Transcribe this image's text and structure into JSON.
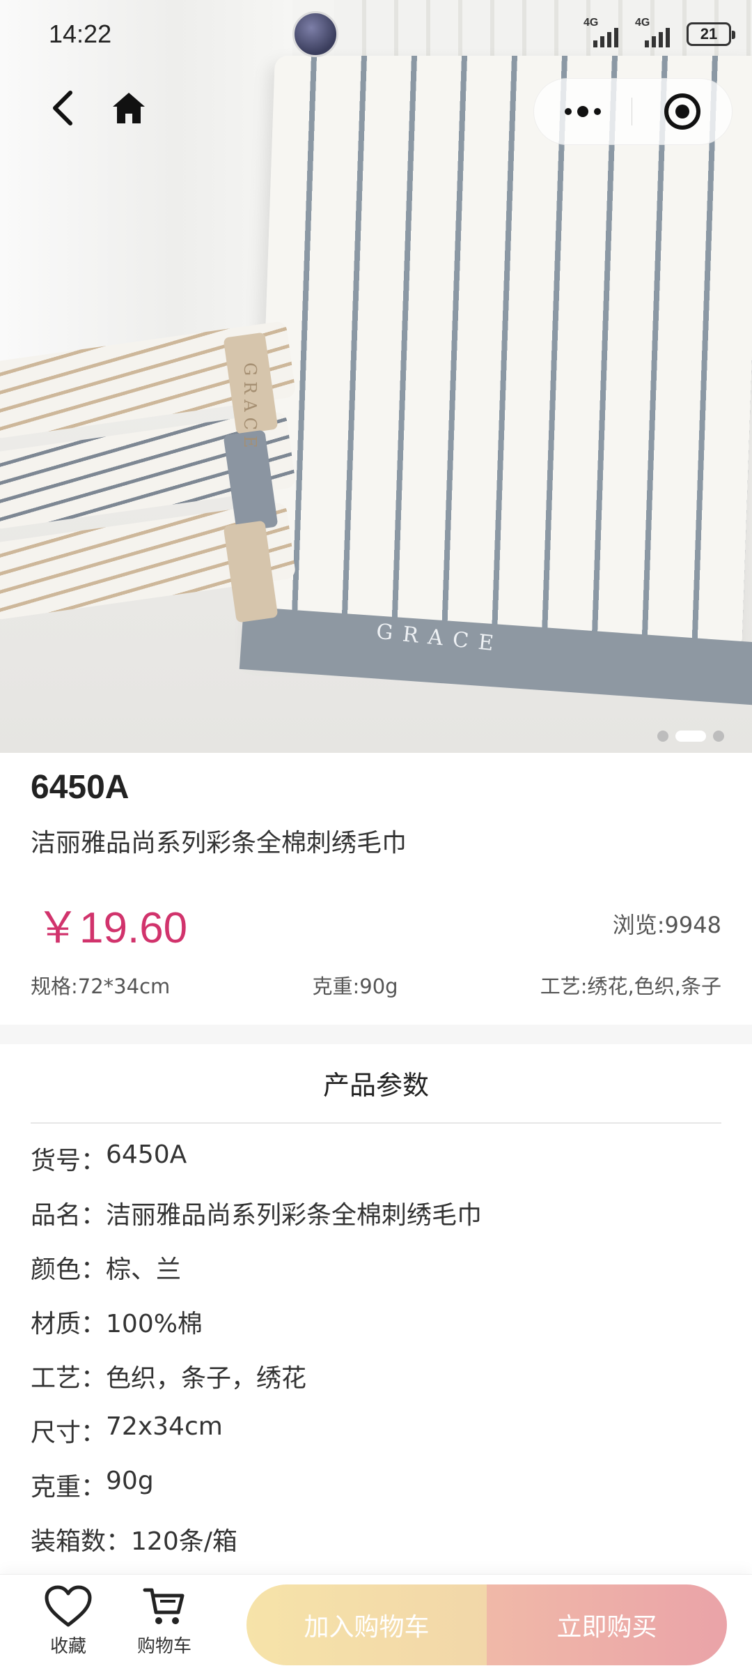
{
  "status_bar": {
    "time": "14:22",
    "network_1": "4G",
    "network_2": "4G",
    "battery": "21"
  },
  "hero": {
    "band_text": "GRACE",
    "stack_band_text": "GRACE",
    "slide_count": 3,
    "active_slide": 2
  },
  "product": {
    "code": "6450A",
    "name": "洁丽雅品尚系列彩条全棉刺绣毛巾",
    "price": "￥19.60",
    "views": "浏览:9948",
    "specs": {
      "size": "规格:72*34cm",
      "weight": "克重:90g",
      "craft": "工艺:绣花,色织,条子"
    }
  },
  "params": {
    "title": "产品参数",
    "rows": [
      {
        "key": "货号：",
        "value": "6450A"
      },
      {
        "key": "品名：",
        "value": "洁丽雅品尚系列彩条全棉刺绣毛巾"
      },
      {
        "key": "颜色：",
        "value": "棕、兰"
      },
      {
        "key": "材质：",
        "value": "100%棉"
      },
      {
        "key": "工艺：",
        "value": "色织，条子，绣花"
      },
      {
        "key": "尺寸：",
        "value": "72x34cm"
      },
      {
        "key": "克重：",
        "value": "90g"
      },
      {
        "key": "装箱数：",
        "value": "120条/箱"
      }
    ]
  },
  "bottom_bar": {
    "favorite_label": "收藏",
    "cart_label": "购物车",
    "add_to_cart": "加入购物车",
    "buy_now": "立即购买"
  },
  "colors": {
    "price": "#d1336c",
    "cart_button": "#f6e3a9",
    "buy_button": "#eaa3a8"
  },
  "icons": [
    "back-icon",
    "home-icon",
    "more-icon",
    "target-icon",
    "heart-icon",
    "cart-icon"
  ]
}
